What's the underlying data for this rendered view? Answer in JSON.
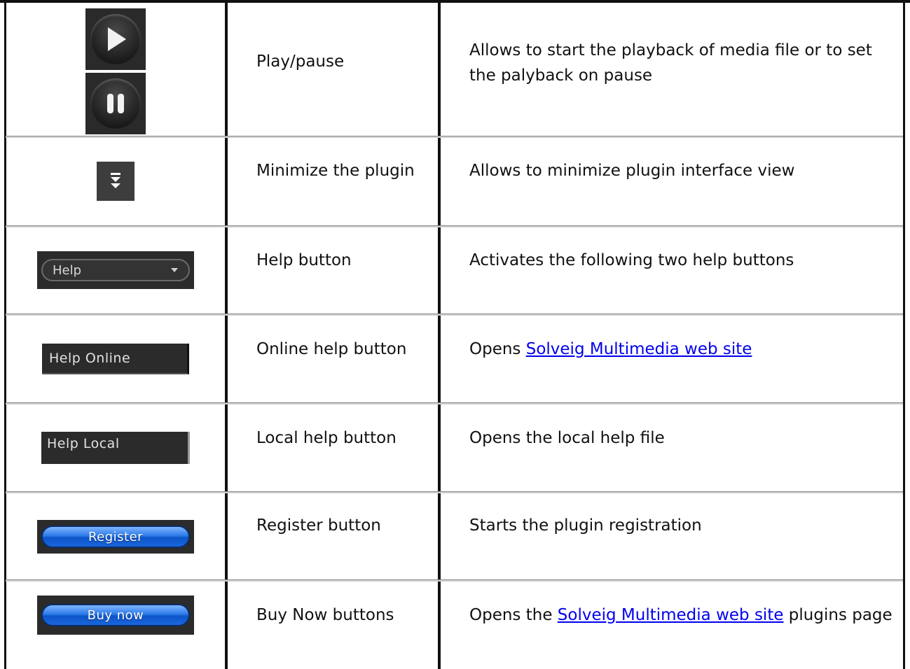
{
  "rows": [
    {
      "icon": "play-pause-icon",
      "name": "Play/pause",
      "desc": "Allows to start the playback of media file or to set the palyback on pause"
    },
    {
      "icon": "minimize-chevrons-icon",
      "name": "Minimize the plugin",
      "desc": "Allows to minimize plugin interface view"
    },
    {
      "icon": "help-dropdown-image",
      "icon_label": "Help",
      "name": "Help button",
      "desc": "Activates the following two help buttons"
    },
    {
      "icon": "help-online-image",
      "icon_label": "Help Online",
      "name": "Online help button",
      "desc_prefix": "Opens ",
      "desc_link": "Solveig Multimedia web site",
      "desc_suffix": ""
    },
    {
      "icon": "help-local-image",
      "icon_label": "Help Local",
      "name": "Local help button",
      "desc": "Opens the local help file"
    },
    {
      "icon": "register-button-image",
      "icon_label": "Register",
      "name": "Register button",
      "desc": "Starts the plugin registration"
    },
    {
      "icon": "buy-now-button-image",
      "icon_label": "Buy now",
      "name": "Buy Now buttons",
      "desc_prefix": "Opens the ",
      "desc_link": "Solveig Multimedia web site",
      "desc_suffix": " plugins page"
    }
  ],
  "colors": {
    "grid": "#111111",
    "row_divider": "#cfcfcf",
    "link": "#0000ee",
    "icon_dark": "#2b2b2b",
    "blue_button": "#1a66dc"
  }
}
